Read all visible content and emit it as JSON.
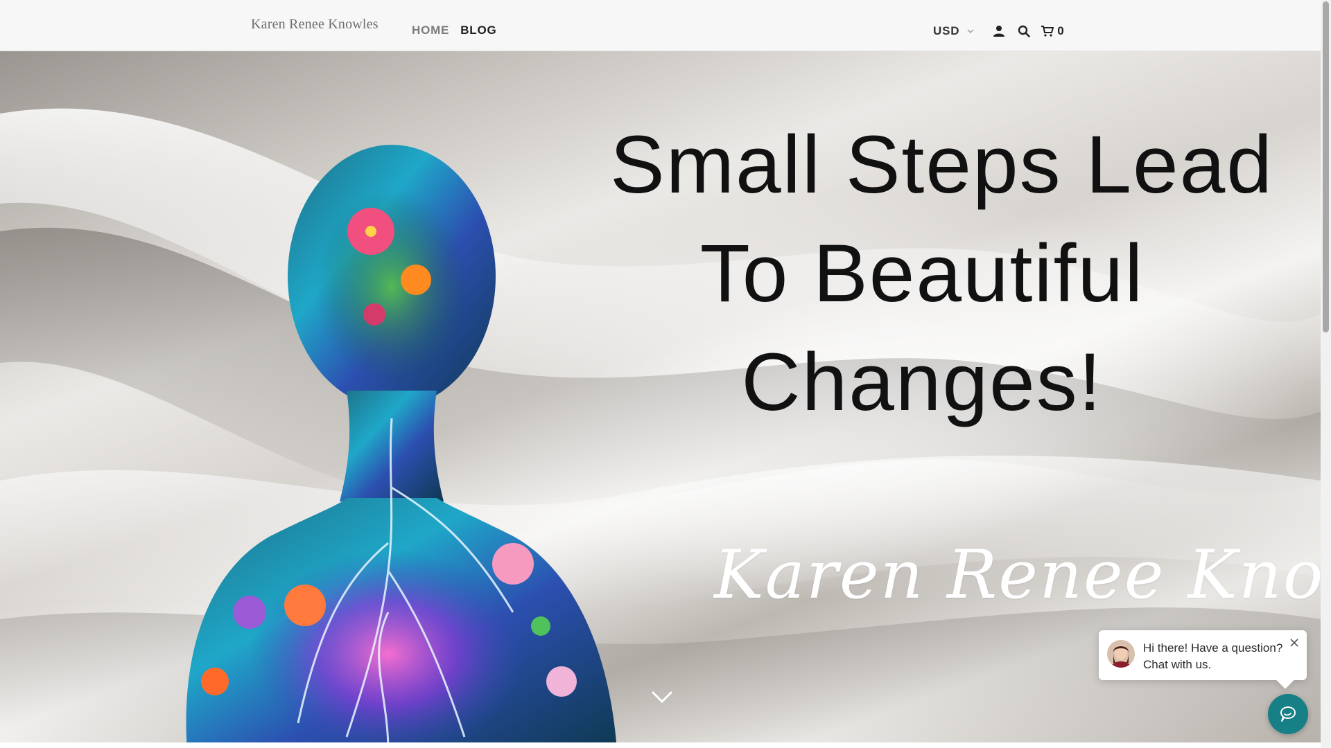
{
  "header": {
    "logo": "Karen Renee Knowles",
    "nav": {
      "home": "HOME",
      "blog": "BLOG"
    },
    "currency": "USD",
    "cart_count": "0",
    "icons": [
      "user-icon",
      "search-icon",
      "cart-icon",
      "chevron-down-icon"
    ]
  },
  "hero": {
    "headline": [
      "Small Steps Lead",
      "To Beautiful",
      "Changes!"
    ],
    "signature": "Karen Renee Knowles",
    "scroll_icon": "chevron-down-icon"
  },
  "chat": {
    "line1": "Hi there! Have a question?",
    "line2": "Chat with us.",
    "close_icon": "close-icon",
    "launcher_icon": "chat-icon"
  },
  "colors": {
    "header_bg": "#f7f7f7",
    "nav_active": "#1c1c1c",
    "nav_inactive": "#7b7b7b",
    "chat_accent": "#177f86"
  }
}
